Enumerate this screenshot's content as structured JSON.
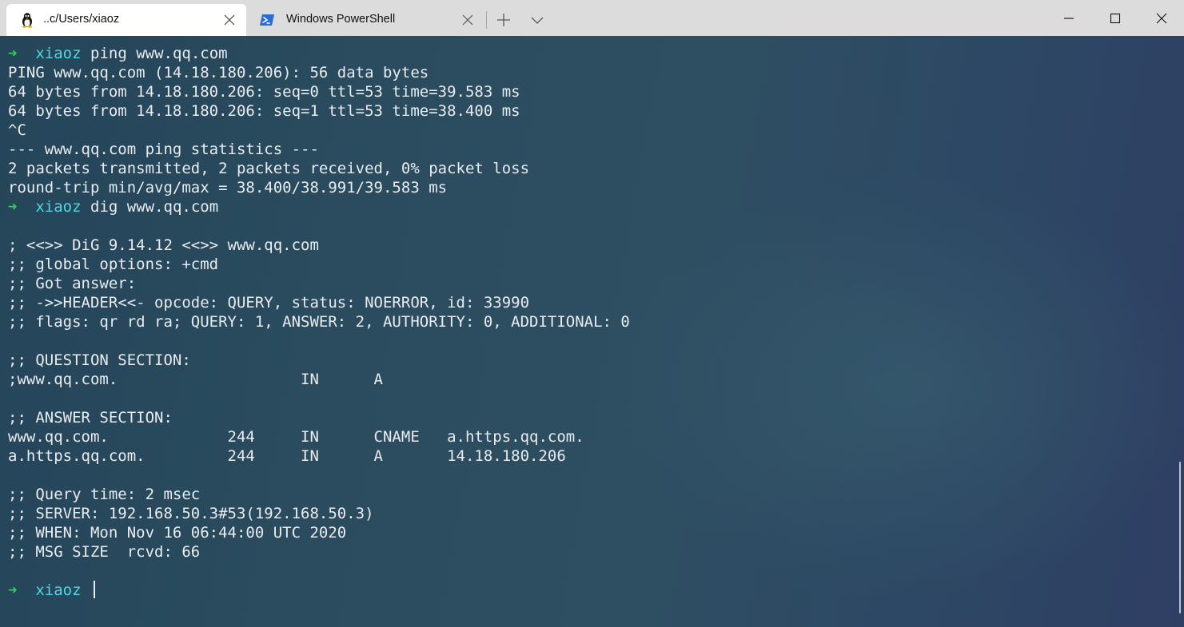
{
  "tabs": [
    {
      "title": "..c/Users/xiaoz",
      "icon": "linux-tux-icon",
      "active": true
    },
    {
      "title": "Windows PowerShell",
      "icon": "powershell-icon",
      "active": false
    }
  ],
  "colors": {
    "prompt_arrow": "#2fd05a",
    "prompt_user": "#4cd8e0",
    "text": "#e8ecef",
    "tabbar_bg": "#dcdcdc"
  },
  "terminal": {
    "prompt": {
      "arrow": "➜",
      "user": "xiaoz"
    },
    "lines": [
      {
        "type": "prompt",
        "command": "ping www.qq.com"
      },
      {
        "type": "output",
        "text": "PING www.qq.com (14.18.180.206): 56 data bytes"
      },
      {
        "type": "output",
        "text": "64 bytes from 14.18.180.206: seq=0 ttl=53 time=39.583 ms"
      },
      {
        "type": "output",
        "text": "64 bytes from 14.18.180.206: seq=1 ttl=53 time=38.400 ms"
      },
      {
        "type": "output",
        "text": "^C"
      },
      {
        "type": "output",
        "text": "--- www.qq.com ping statistics ---"
      },
      {
        "type": "output",
        "text": "2 packets transmitted, 2 packets received, 0% packet loss"
      },
      {
        "type": "output",
        "text": "round-trip min/avg/max = 38.400/38.991/39.583 ms"
      },
      {
        "type": "prompt",
        "command": "dig www.qq.com"
      },
      {
        "type": "output",
        "text": ""
      },
      {
        "type": "output",
        "text": "; <<>> DiG 9.14.12 <<>> www.qq.com"
      },
      {
        "type": "output",
        "text": ";; global options: +cmd"
      },
      {
        "type": "output",
        "text": ";; Got answer:"
      },
      {
        "type": "output",
        "text": ";; ->>HEADER<<- opcode: QUERY, status: NOERROR, id: 33990"
      },
      {
        "type": "output",
        "text": ";; flags: qr rd ra; QUERY: 1, ANSWER: 2, AUTHORITY: 0, ADDITIONAL: 0"
      },
      {
        "type": "output",
        "text": ""
      },
      {
        "type": "output",
        "text": ";; QUESTION SECTION:"
      },
      {
        "type": "output",
        "text": ";www.qq.com.                    IN      A"
      },
      {
        "type": "output",
        "text": ""
      },
      {
        "type": "output",
        "text": ";; ANSWER SECTION:"
      },
      {
        "type": "output",
        "text": "www.qq.com.             244     IN      CNAME   a.https.qq.com."
      },
      {
        "type": "output",
        "text": "a.https.qq.com.         244     IN      A       14.18.180.206"
      },
      {
        "type": "output",
        "text": ""
      },
      {
        "type": "output",
        "text": ";; Query time: 2 msec"
      },
      {
        "type": "output",
        "text": ";; SERVER: 192.168.50.3#53(192.168.50.3)"
      },
      {
        "type": "output",
        "text": ";; WHEN: Mon Nov 16 06:44:00 UTC 2020"
      },
      {
        "type": "output",
        "text": ";; MSG SIZE  rcvd: 66"
      },
      {
        "type": "output",
        "text": ""
      },
      {
        "type": "prompt",
        "command": "",
        "cursor": true
      }
    ]
  }
}
